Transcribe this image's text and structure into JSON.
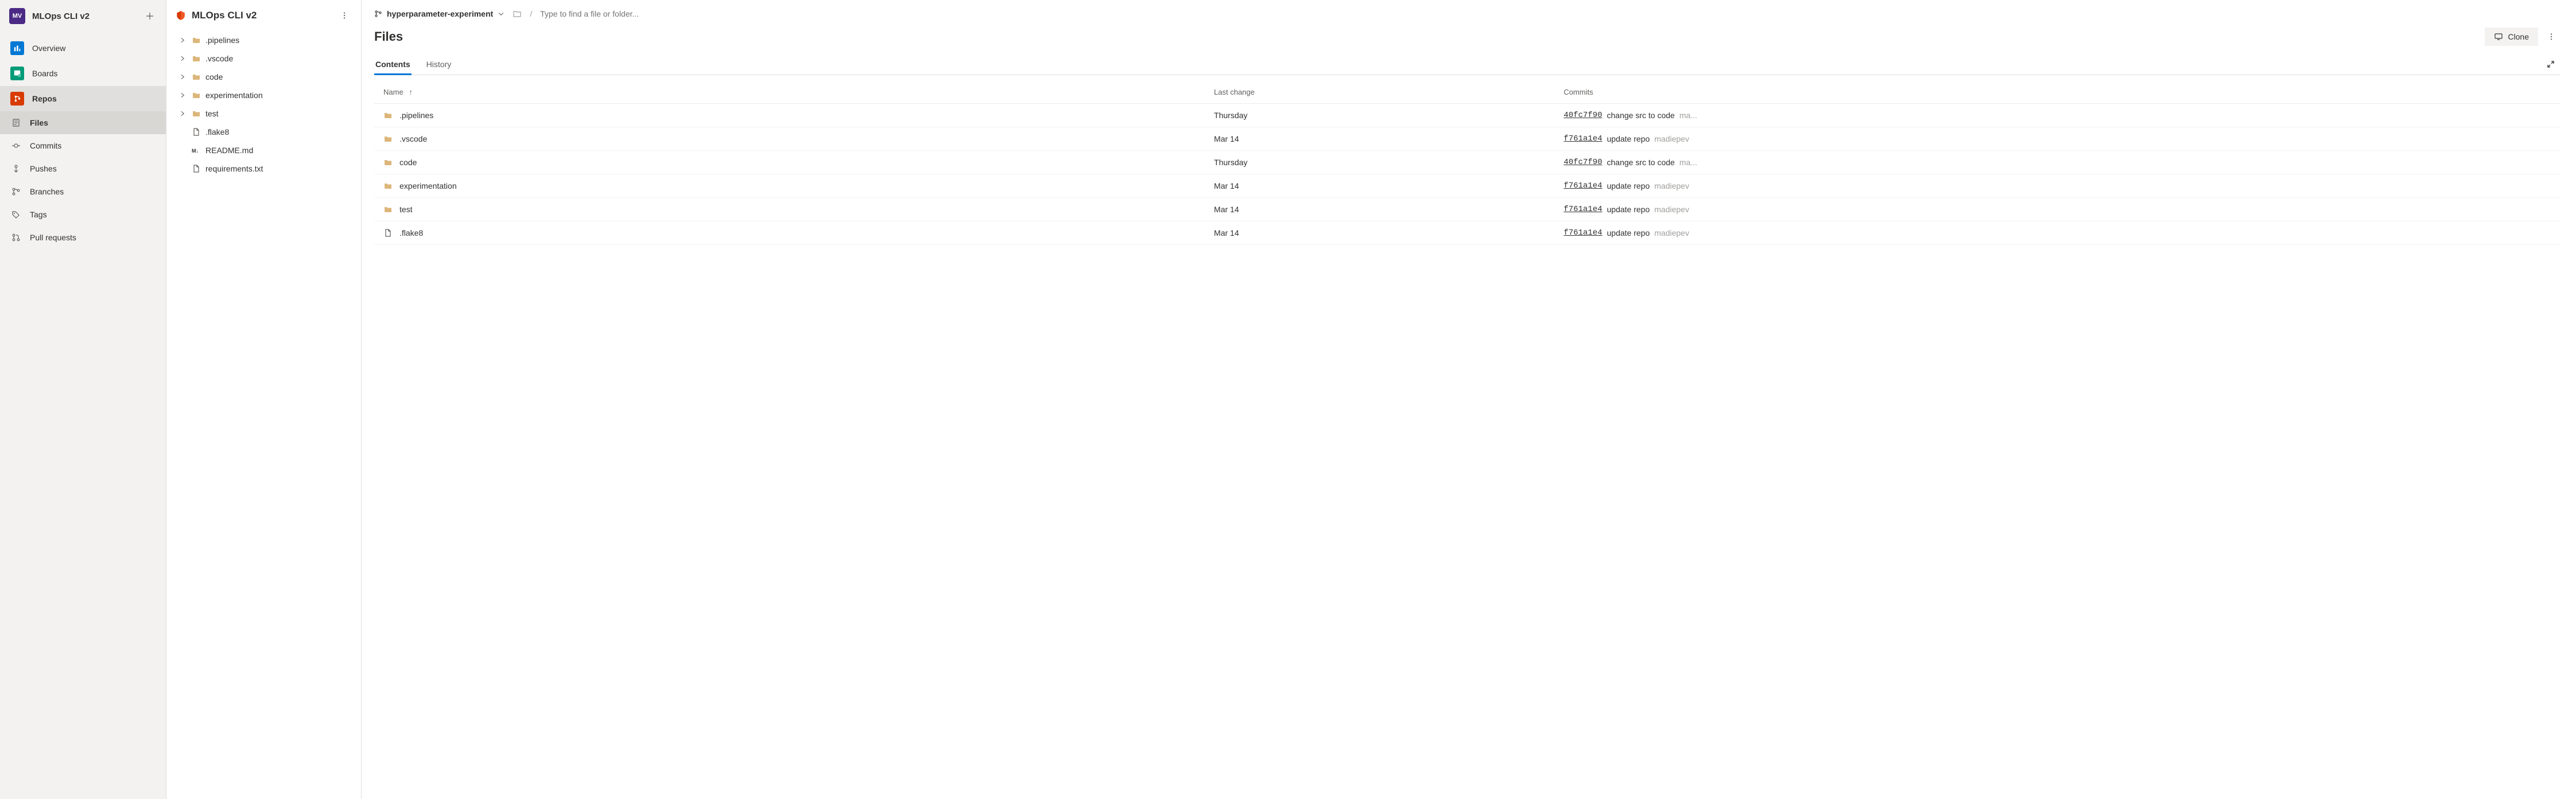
{
  "project": {
    "badge": "MV",
    "name": "MLOps CLI v2"
  },
  "nav": {
    "overview": "Overview",
    "boards": "Boards",
    "repos": "Repos",
    "repos_sub": {
      "files": "Files",
      "commits": "Commits",
      "pushes": "Pushes",
      "branches": "Branches",
      "tags": "Tags",
      "pull_requests": "Pull requests"
    }
  },
  "tree": {
    "repo_name": "MLOps CLI v2",
    "items": [
      {
        "type": "folder",
        "name": ".pipelines",
        "expandable": true
      },
      {
        "type": "folder",
        "name": ".vscode",
        "expandable": true
      },
      {
        "type": "folder",
        "name": "code",
        "expandable": true
      },
      {
        "type": "folder",
        "name": "experimentation",
        "expandable": true
      },
      {
        "type": "folder",
        "name": "test",
        "expandable": true
      },
      {
        "type": "file",
        "name": ".flake8",
        "icon": "file"
      },
      {
        "type": "file",
        "name": "README.md",
        "icon": "md"
      },
      {
        "type": "file",
        "name": "requirements.txt",
        "icon": "file"
      }
    ]
  },
  "breadcrumb": {
    "branch": "hyperparameter-experiment",
    "search_placeholder": "Type to find a file or folder..."
  },
  "page": {
    "heading": "Files",
    "clone": "Clone",
    "tabs": {
      "contents": "Contents",
      "history": "History"
    }
  },
  "table": {
    "headers": {
      "name": "Name",
      "last_change": "Last change",
      "commits": "Commits"
    },
    "rows": [
      {
        "type": "folder",
        "name": ".pipelines",
        "last": "Thursday",
        "hash": "40fc7f90",
        "msg": "change src to code",
        "author": "ma..."
      },
      {
        "type": "folder",
        "name": ".vscode",
        "last": "Mar 14",
        "hash": "f761a1e4",
        "msg": "update repo",
        "author": "madiepev"
      },
      {
        "type": "folder",
        "name": "code",
        "last": "Thursday",
        "hash": "40fc7f90",
        "msg": "change src to code",
        "author": "ma..."
      },
      {
        "type": "folder",
        "name": "experimentation",
        "last": "Mar 14",
        "hash": "f761a1e4",
        "msg": "update repo",
        "author": "madiepev"
      },
      {
        "type": "folder",
        "name": "test",
        "last": "Mar 14",
        "hash": "f761a1e4",
        "msg": "update repo",
        "author": "madiepev"
      },
      {
        "type": "file",
        "name": ".flake8",
        "last": "Mar 14",
        "hash": "f761a1e4",
        "msg": "update repo",
        "author": "madiepev"
      }
    ]
  }
}
